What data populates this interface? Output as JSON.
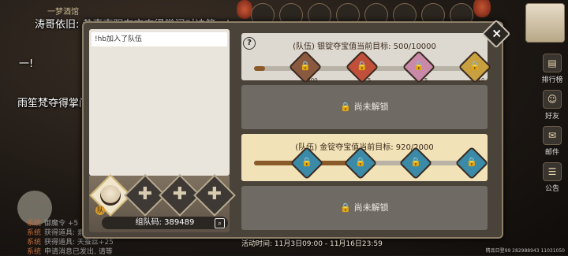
{
  "background": {
    "title": "一梦酒馆",
    "broadcast_1": "涛哥依旧: 恭喜南阳布衣夺得掌门对决第一!",
    "broadcast_2": "一!",
    "broadcast_3": "雨笙梵夺得掌门对决第一!",
    "chat": [
      {
        "tag": "系统",
        "text": "御魔令 +5"
      },
      {
        "tag": "系统",
        "text": "获得道具: 素"
      },
      {
        "tag": "系统",
        "text": "获得道具: 天蚕丝+25"
      },
      {
        "tag": "系统",
        "text": "申请消息已发出, 请等"
      }
    ],
    "sidebar": [
      "排行榜",
      "好友",
      "邮件",
      "公告"
    ],
    "activity_time": "活动时间: 11月3日09:00 - 11月16日23:59",
    "status_text": "精品日登99 282988943 11031050"
  },
  "team": {
    "log_entry": "!hb加入了队伍",
    "code_label": "组队码: 389489",
    "leader_badge": "队"
  },
  "silver": {
    "title": "(队伍) 银锭夺宝值当前目标: 500/10000",
    "progress": 0.05,
    "rewards": [
      {
        "count": "300",
        "color": "#8a5a40"
      },
      {
        "count": "5",
        "color": "#c0503a"
      },
      {
        "count": "5",
        "color": "#c88aa8"
      },
      {
        "count": "10",
        "color": "#c8a040"
      }
    ],
    "locked_text": "尚未解锁"
  },
  "gold": {
    "title": "(队伍) 金锭夺宝值当前目标: 920/2000",
    "progress": 0.46,
    "rewards": [
      {
        "count": "",
        "color": "#3a8aa8"
      },
      {
        "count": "",
        "color": "#3a8aa8"
      },
      {
        "count": "",
        "color": "#3a8aa8"
      },
      {
        "count": "",
        "color": "#3a8aa8"
      },
      {
        "count": "",
        "color": "#3a8aa8"
      }
    ],
    "locked_text": "尚未解锁"
  },
  "icons": {
    "lock_glyph": "🔒",
    "plus_glyph": "✚",
    "close_glyph": "×",
    "help_glyph": "?"
  }
}
